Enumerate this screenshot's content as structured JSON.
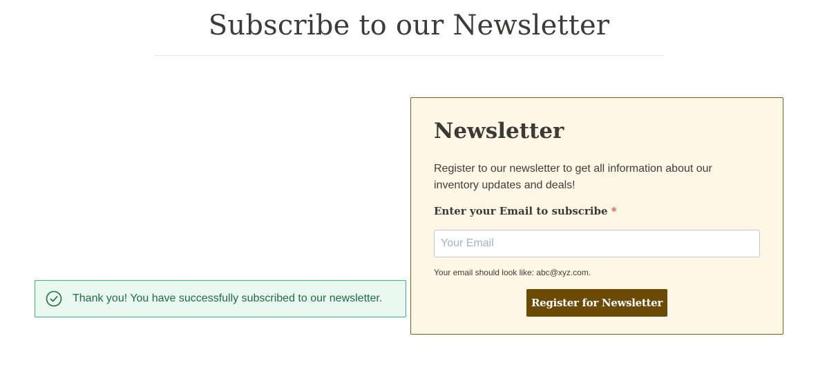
{
  "page": {
    "title": "Subscribe to our Newsletter"
  },
  "alert": {
    "icon": "check-circle-icon",
    "message": "Thank you! You have successfully subscribed to our newsletter.",
    "colors": {
      "background": "#e9f9f1",
      "border": "#3fb37a",
      "text": "#1f6a45"
    }
  },
  "newsletter": {
    "heading": "Newsletter",
    "description": "Register to our newsletter to get all information about our inventory updates and deals!",
    "email_label": "Enter your Email to subscribe",
    "required_marker": "*",
    "email_value": "",
    "email_placeholder": "Your Email",
    "email_hint": "Your email should look like: abc@xyz.com.",
    "submit_label": "Register for Newsletter",
    "colors": {
      "card_background": "#fef7e6",
      "card_border": "#7a5a1e",
      "button_background": "#6b4a06",
      "required_marker": "#e4504a"
    }
  }
}
